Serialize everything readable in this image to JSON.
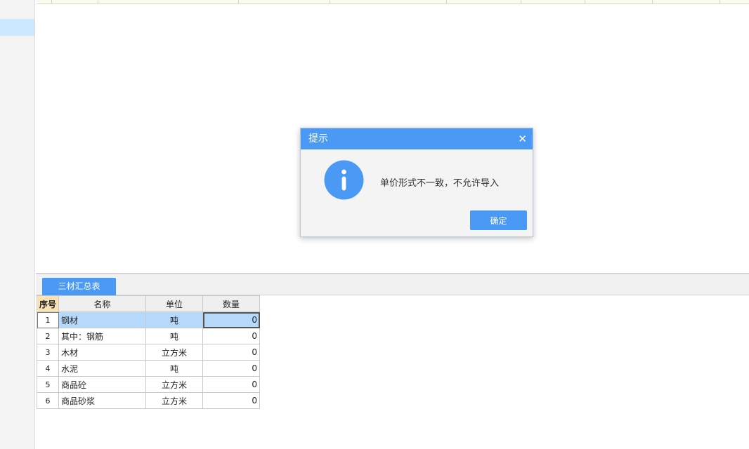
{
  "bottom_panel": {
    "tab_label": "三材汇总表",
    "table": {
      "headers": {
        "index": "序号",
        "name": "名称",
        "unit": "单位",
        "quantity": "数量"
      },
      "rows": [
        {
          "index": "1",
          "name": "钢材",
          "unit": "吨",
          "quantity": "0"
        },
        {
          "index": "2",
          "name": "其中：钢筋",
          "unit": "吨",
          "quantity": "0"
        },
        {
          "index": "3",
          "name": "木材",
          "unit": "立方米",
          "quantity": "0"
        },
        {
          "index": "4",
          "name": "水泥",
          "unit": "吨",
          "quantity": "0"
        },
        {
          "index": "5",
          "name": "商品砼",
          "unit": "立方米",
          "quantity": "0"
        },
        {
          "index": "6",
          "name": "商品砂浆",
          "unit": "立方米",
          "quantity": "0"
        }
      ],
      "selected_row": "1"
    }
  },
  "dialog": {
    "title": "提示",
    "close_glyph": "✕",
    "icon": "info-icon",
    "message": "单价形式不一致，不允许导入",
    "ok_label": "确定"
  },
  "colors": {
    "accent": "#4a9af5",
    "selection": "#b6d8fb",
    "index_header": "#f8e2b6"
  }
}
